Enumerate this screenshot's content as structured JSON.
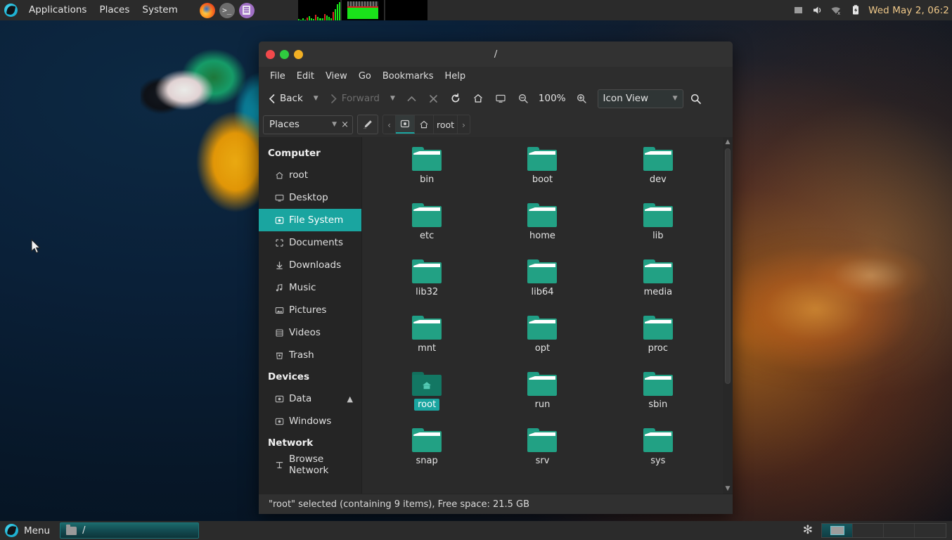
{
  "top_panel": {
    "logo_name": "parrot-logo",
    "menus": [
      "Applications",
      "Places",
      "System"
    ],
    "launchers": [
      {
        "name": "firefox-launcher",
        "label": "Firefox"
      },
      {
        "name": "terminal-launcher",
        "label": ">_"
      },
      {
        "name": "text-editor-launcher",
        "label": "Text Editor"
      }
    ],
    "monitors": [
      "cpu-monitor",
      "memory-monitor",
      "network-monitor"
    ],
    "tray": [
      "display-icon",
      "volume-icon",
      "network-disconnected-icon",
      "battery-icon"
    ],
    "clock": "Wed May  2, 06:2"
  },
  "window": {
    "title": "/",
    "controls": {
      "close": "close-button",
      "minimize": "minimize-button",
      "maximize": "maximize-button"
    },
    "menubar": [
      "File",
      "Edit",
      "View",
      "Go",
      "Bookmarks",
      "Help"
    ],
    "toolbar": {
      "back_label": "Back",
      "forward_label": "Forward",
      "up_label": "Up",
      "stop_label": "Stop",
      "reload_label": "Reload",
      "home_label": "Home",
      "display_label": "Display",
      "zoom_out_label": "Zoom Out",
      "zoom_level": "100%",
      "zoom_in_label": "Zoom In",
      "view_mode": "Icon View",
      "search_label": "Search"
    },
    "location_bar": {
      "places_label": "Places",
      "close_label": "×",
      "edit_path_label": "edit-path",
      "breadcrumb": [
        "‹",
        "filesystem-icon",
        "home-icon",
        "root",
        "›"
      ]
    },
    "sidebar": {
      "groups": [
        {
          "title": "Computer",
          "items": [
            {
              "label": "root",
              "icon": "home-icon",
              "selected": false
            },
            {
              "label": "Desktop",
              "icon": "desktop-icon",
              "selected": false
            },
            {
              "label": "File System",
              "icon": "drive-icon",
              "selected": true
            },
            {
              "label": "Documents",
              "icon": "documents-icon",
              "selected": false
            },
            {
              "label": "Downloads",
              "icon": "downloads-icon",
              "selected": false
            },
            {
              "label": "Music",
              "icon": "music-icon",
              "selected": false
            },
            {
              "label": "Pictures",
              "icon": "pictures-icon",
              "selected": false
            },
            {
              "label": "Videos",
              "icon": "videos-icon",
              "selected": false
            },
            {
              "label": "Trash",
              "icon": "trash-icon",
              "selected": false
            }
          ]
        },
        {
          "title": "Devices",
          "items": [
            {
              "label": "Data",
              "icon": "drive-icon",
              "selected": false,
              "eject": true
            },
            {
              "label": "Windows",
              "icon": "drive-icon",
              "selected": false
            }
          ]
        },
        {
          "title": "Network",
          "items": [
            {
              "label": "Browse Network",
              "icon": "network-icon",
              "selected": false
            }
          ]
        }
      ]
    },
    "files": [
      {
        "name": "bin",
        "selected": false
      },
      {
        "name": "boot",
        "selected": false
      },
      {
        "name": "dev",
        "selected": false
      },
      {
        "name": "etc",
        "selected": false
      },
      {
        "name": "home",
        "selected": false
      },
      {
        "name": "lib",
        "selected": false
      },
      {
        "name": "lib32",
        "selected": false
      },
      {
        "name": "lib64",
        "selected": false
      },
      {
        "name": "media",
        "selected": false
      },
      {
        "name": "mnt",
        "selected": false
      },
      {
        "name": "opt",
        "selected": false
      },
      {
        "name": "proc",
        "selected": false
      },
      {
        "name": "root",
        "selected": true
      },
      {
        "name": "run",
        "selected": false
      },
      {
        "name": "sbin",
        "selected": false
      },
      {
        "name": "snap",
        "selected": false
      },
      {
        "name": "srv",
        "selected": false
      },
      {
        "name": "sys",
        "selected": false
      }
    ],
    "status": "\"root\" selected (containing 9 items), Free space: 21.5 GB"
  },
  "bottom_panel": {
    "start_label": "Menu",
    "tasks": [
      {
        "label": "/",
        "icon": "folder-icon",
        "active": true
      }
    ],
    "tray_asterisk": "✻",
    "workspaces": 4,
    "active_workspace": 1
  },
  "colors": {
    "accent_teal": "#1aa5a0",
    "folder_teal": "#22a184",
    "panel_bg": "#2b2b2b",
    "window_bg": "#2d2d2d",
    "content_bg": "#2a2a2a"
  }
}
